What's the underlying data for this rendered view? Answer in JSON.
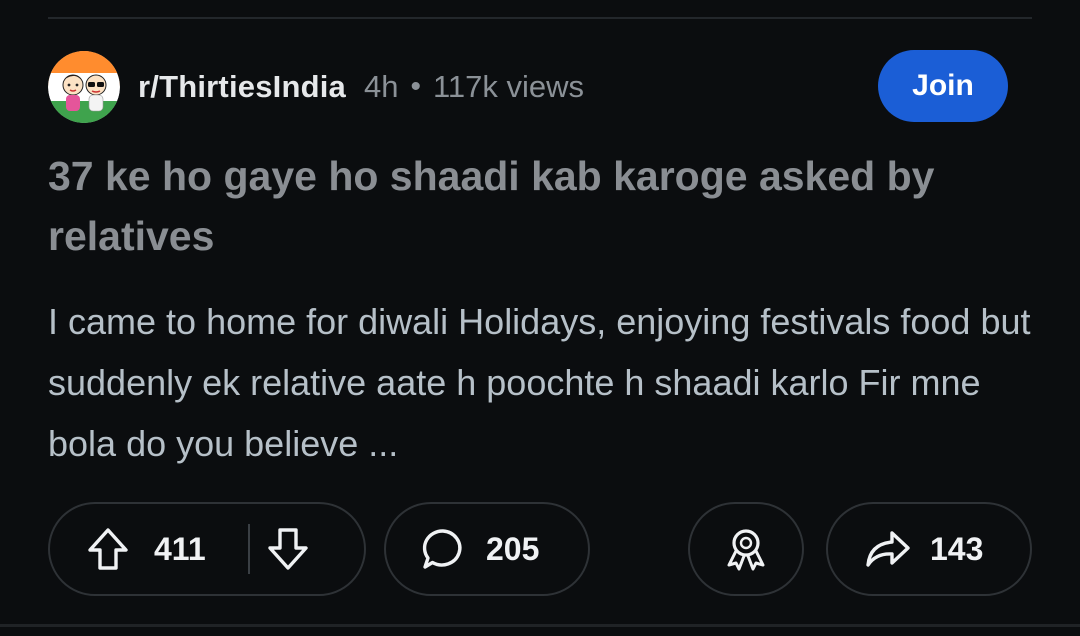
{
  "post": {
    "subreddit": "r/ThirtiesIndia",
    "age": "4h",
    "separator": "•",
    "views": "117k views",
    "join_label": "Join",
    "title": "37 ke ho gaye ho shaadi kab karoge asked by relatives",
    "body": "I came to home for diwali Holidays, enjoying festivals food but suddenly ek relative aate h poochte h shaadi karlo Fir mne bola do you believe ..."
  },
  "actions": {
    "upvotes": "411",
    "comments": "205",
    "shares": "143"
  },
  "icons": {
    "avatar": "subreddit-avatar",
    "upvote": "arrow-up-icon",
    "downvote": "arrow-down-icon",
    "comment": "comment-bubble-icon",
    "award": "award-ribbon-icon",
    "share": "share-arrow-icon"
  },
  "colors": {
    "background": "#0b0d0f",
    "join_button": "#1b5ed6",
    "title_text": "#8a8e93",
    "body_text": "#b6c0c8",
    "meta_text": "#8b9197",
    "pill_border": "#2e3236"
  }
}
